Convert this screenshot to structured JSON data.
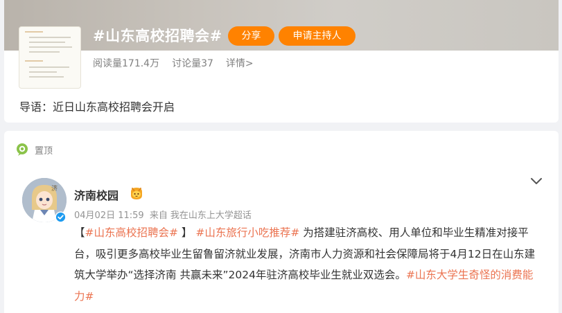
{
  "topic": {
    "title": "#山东高校招聘会#",
    "share_label": "分享",
    "host_label": "申请主持人",
    "reads": "阅读量171.4万",
    "discussions": "讨论量37",
    "detail": "详情>",
    "intro": "导语：近日山东高校招聘会开启"
  },
  "feed": {
    "pin_label": "置顶",
    "post": {
      "author": "济南校园",
      "date": "04月02日 11:59",
      "source_prefix": "来自",
      "source": "我在山东上大学超话",
      "bracket_open": "【",
      "tag1": "#山东高校招聘会#",
      "bracket_close": " 】",
      "tag2": "#山东旅行小吃推荐#",
      "body": " 为搭建驻济高校、用人单位和毕业生精准对接平台，吸引更多高校毕业生留鲁留济就业发展，济南市人力资源和社会保障局将于4月12日在山东建筑大学举办“选择济南 共赢未来”2024年驻济高校毕业生就业双选会。",
      "tag3": "#山东大学生奇怪的消费能力#"
    }
  },
  "colors": {
    "accent": "#ff8200",
    "topic_link": "#eb7350",
    "verified_blue": "#1d9bf0"
  },
  "icons": [
    "pin-icon",
    "chevron-down-icon",
    "verified-icon",
    "author-badge-icon"
  ]
}
